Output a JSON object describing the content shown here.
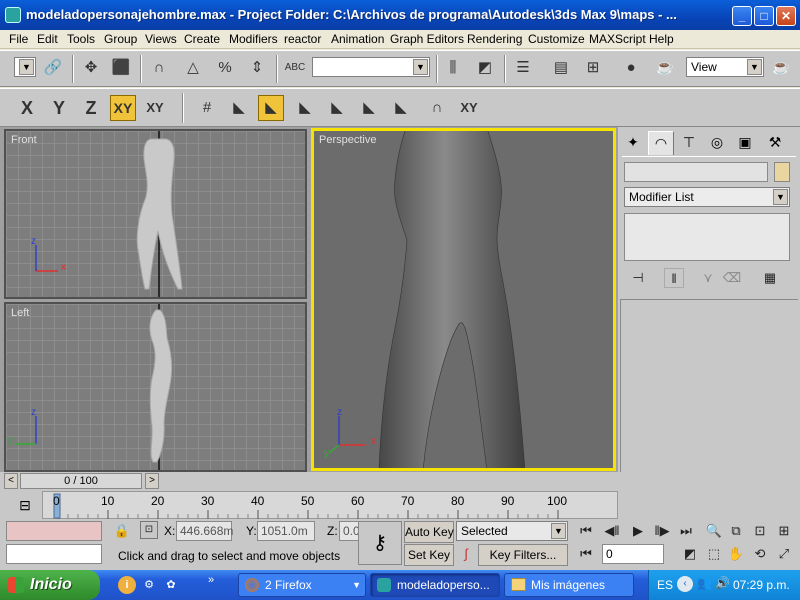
{
  "window": {
    "title": "modeladopersonajehombre.max    - Project Folder: C:\\Archivos de programa\\Autodesk\\3ds Max 9\\maps    - ...",
    "minimize_icon": "minimize-icon",
    "maximize_icon": "maximize-icon",
    "close_icon": "close-icon"
  },
  "menu": [
    "File",
    "Edit",
    "Tools",
    "Group",
    "Views",
    "Create",
    "Modifiers",
    "reactor",
    "Animation",
    "Graph Editors",
    "Rendering",
    "Customize",
    "MAXScript",
    "Help"
  ],
  "toolbar": {
    "selection_set_value": "",
    "view_value": "View",
    "axis_buttons": [
      "X",
      "Y",
      "Z",
      "XY",
      "XY"
    ],
    "active_axis": "XY"
  },
  "viewports": {
    "front": "Front",
    "left": "Left",
    "perspective": "Perspective",
    "axis_x": "x",
    "axis_z": "z",
    "axis_y": "y"
  },
  "command_panel": {
    "object_name_value": "",
    "modifier_list": "Modifier List",
    "active_tab": "Modify"
  },
  "timeline": {
    "slider_value": "0 / 100",
    "ticks": [
      "0",
      "10",
      "20",
      "30",
      "40",
      "50",
      "60",
      "70",
      "80",
      "90",
      "100"
    ]
  },
  "status": {
    "x_label": "X:",
    "x_value": "446.668m",
    "y_label": "Y:",
    "y_value": "1051.0m",
    "z_label": "Z:",
    "z_value": "0.0",
    "prompt": "Click and drag to select and move objects",
    "auto_key": "Auto Key",
    "set_key": "Set Key",
    "key_filter_mode": "Selected",
    "key_filters": "Key Filters...",
    "current_frame": "0"
  },
  "taskbar": {
    "start": "Inicio",
    "tasks": [
      {
        "label": "2 Firefox",
        "active": false
      },
      {
        "label": "modeladoperso...",
        "active": true
      },
      {
        "label": "Mis imágenes",
        "active": false
      }
    ],
    "language": "ES",
    "clock": "07:29 p.m."
  },
  "colors": {
    "active_viewport_border": "#f5e400",
    "active_button": "#f0c33a",
    "xp_titlebar": "#0844b8",
    "xp_start": "#3b9a37"
  }
}
